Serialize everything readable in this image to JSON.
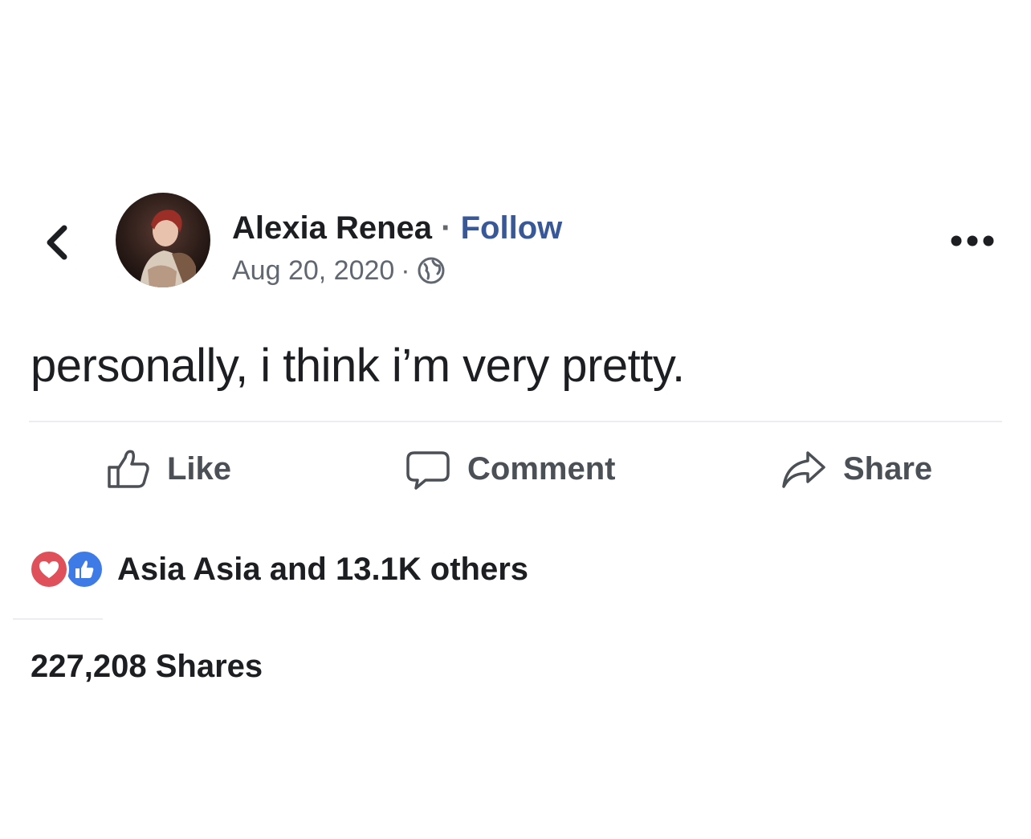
{
  "header": {
    "back_icon": "chevron-left-icon",
    "author_name": "Alexia Renea",
    "separator": "·",
    "follow_label": "Follow",
    "date": "Aug 20, 2020",
    "meta_separator": "·",
    "privacy_icon": "globe-icon",
    "more_icon": "more-horizontal-icon"
  },
  "post": {
    "text": "personally, i think i’m very pretty."
  },
  "actions": [
    {
      "label": "Like",
      "icon": "thumbs-up-icon"
    },
    {
      "label": "Comment",
      "icon": "comment-icon"
    },
    {
      "label": "Share",
      "icon": "share-icon"
    }
  ],
  "reactions": {
    "icons": [
      "heart-reaction-icon",
      "like-reaction-icon"
    ],
    "summary": "Asia Asia and 13.1K others"
  },
  "shares": {
    "label": "227,208 Shares"
  },
  "colors": {
    "follow": "#385898",
    "heart": "#e0505a",
    "like": "#3f7be6",
    "secondary_text": "#606770",
    "action_text": "#4b4f56"
  }
}
